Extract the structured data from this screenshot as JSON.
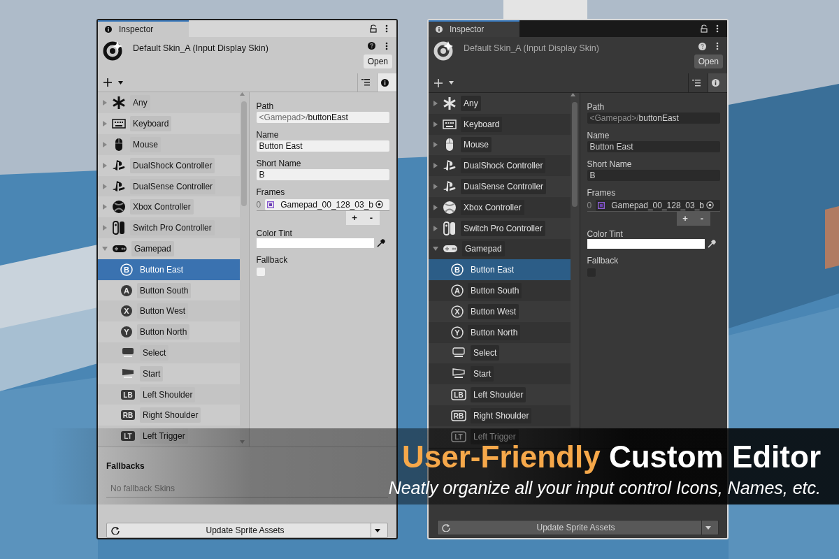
{
  "inspectors": [
    {
      "kind": "light",
      "tab": "Inspector",
      "asset_title": "Default Skin_A (Input Display Skin)",
      "open_button": "Open",
      "tree": [
        {
          "label": "Any",
          "expanded": false,
          "selected": false
        },
        {
          "label": "Keyboard",
          "expanded": false,
          "selected": false
        },
        {
          "label": "Mouse",
          "expanded": false,
          "selected": false
        },
        {
          "label": "DualShock Controller",
          "expanded": false,
          "selected": false
        },
        {
          "label": "DualSense Controller",
          "expanded": false,
          "selected": false
        },
        {
          "label": "Xbox Controller",
          "expanded": false,
          "selected": false
        },
        {
          "label": "Switch Pro Controller",
          "expanded": false,
          "selected": false
        },
        {
          "label": "Gamepad",
          "expanded": true,
          "selected": false,
          "children": [
            {
              "label": "Button East",
              "badge": "B",
              "kind": "round",
              "selected": true
            },
            {
              "label": "Button South",
              "badge": "A",
              "kind": "round",
              "selected": false
            },
            {
              "label": "Button West",
              "badge": "X",
              "kind": "round",
              "selected": false
            },
            {
              "label": "Button North",
              "badge": "Y",
              "kind": "round",
              "selected": false
            },
            {
              "label": "Select",
              "kind": "select",
              "selected": false
            },
            {
              "label": "Start",
              "kind": "start",
              "selected": false
            },
            {
              "label": "Left Shoulder",
              "badge": "LB",
              "kind": "square",
              "selected": false
            },
            {
              "label": "Right Shoulder",
              "badge": "RB",
              "kind": "square",
              "selected": false
            },
            {
              "label": "Left Trigger",
              "badge": "LT",
              "kind": "square",
              "selected": false
            }
          ]
        }
      ],
      "path": {
        "label": "Path",
        "prefix": "<Gamepad>/",
        "value": "buttonEast"
      },
      "name": {
        "label": "Name",
        "value": "Button East"
      },
      "short_name": {
        "label": "Short Name",
        "value": "B"
      },
      "frames": {
        "label": "Frames",
        "items": [
          {
            "index": "0",
            "value": "Gamepad_00_128_03_b"
          }
        ],
        "add": "+",
        "remove": "-"
      },
      "color_tint": {
        "label": "Color Tint"
      },
      "fallback": {
        "label": "Fallback",
        "checked": false
      },
      "fallbacks": {
        "title": "Fallbacks",
        "empty": "No fallback Skins"
      },
      "update_button": "Update Sprite Assets"
    },
    {
      "kind": "dark",
      "tab": "Inspector",
      "asset_title": "Default Skin_A (Input Display Skin)",
      "open_button": "Open",
      "tree": [
        {
          "label": "Any",
          "expanded": false,
          "selected": false
        },
        {
          "label": "Keyboard",
          "expanded": false,
          "selected": false
        },
        {
          "label": "Mouse",
          "expanded": false,
          "selected": false
        },
        {
          "label": "DualShock Controller",
          "expanded": false,
          "selected": false
        },
        {
          "label": "DualSense Controller",
          "expanded": false,
          "selected": false
        },
        {
          "label": "Xbox Controller",
          "expanded": false,
          "selected": false
        },
        {
          "label": "Switch Pro Controller",
          "expanded": false,
          "selected": false
        },
        {
          "label": "Gamepad",
          "expanded": true,
          "selected": false,
          "children": [
            {
              "label": "Button East",
              "badge": "B",
              "kind": "round",
              "selected": true
            },
            {
              "label": "Button South",
              "badge": "A",
              "kind": "round",
              "selected": false
            },
            {
              "label": "Button West",
              "badge": "X",
              "kind": "round",
              "selected": false
            },
            {
              "label": "Button North",
              "badge": "Y",
              "kind": "round",
              "selected": false
            },
            {
              "label": "Select",
              "kind": "select",
              "selected": false
            },
            {
              "label": "Start",
              "kind": "start",
              "selected": false
            },
            {
              "label": "Left Shoulder",
              "badge": "LB",
              "kind": "square",
              "selected": false
            },
            {
              "label": "Right Shoulder",
              "badge": "RB",
              "kind": "square",
              "selected": false
            },
            {
              "label": "Left Trigger",
              "badge": "LT",
              "kind": "square",
              "selected": false
            }
          ]
        }
      ],
      "path": {
        "label": "Path",
        "prefix": "<Gamepad>/",
        "value": "buttonEast"
      },
      "name": {
        "label": "Name",
        "value": "Button East"
      },
      "short_name": {
        "label": "Short Name",
        "value": "B"
      },
      "frames": {
        "label": "Frames",
        "items": [
          {
            "index": "0",
            "value": "Gamepad_00_128_03_b"
          }
        ],
        "add": "+",
        "remove": "-"
      },
      "color_tint": {
        "label": "Color Tint"
      },
      "fallback": {
        "label": "Fallback",
        "checked": false
      },
      "update_button": "Update Sprite Assets"
    }
  ],
  "banner": {
    "highlight": "User-Friendly",
    "title": "Custom Editor",
    "subtitle": "Neatly organize all your input control Icons, Names, etc."
  }
}
